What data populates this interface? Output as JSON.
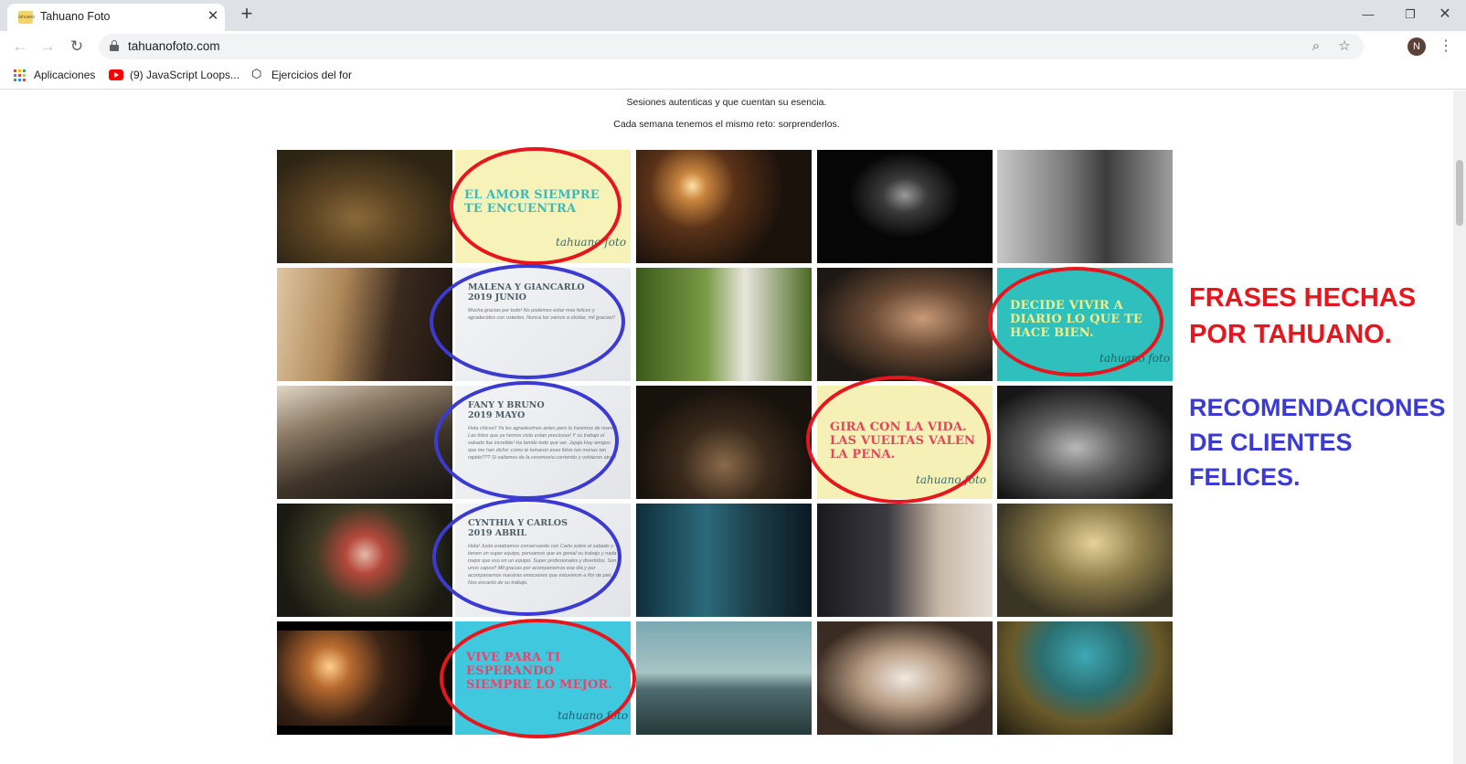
{
  "browser": {
    "tab_title": "Tahuano Foto",
    "favicon_label": "tahuano",
    "url": "tahuanofoto.com",
    "profile_initial": "N",
    "bookmarks": [
      {
        "label": "Aplicaciones"
      },
      {
        "label": "(9) JavaScript Loops..."
      },
      {
        "label": "Ejercicios del for"
      }
    ]
  },
  "page": {
    "intro_lines": [
      "Sesiones autenticas y que cuentan su esencia.",
      "Cada semana tenemos el mismo reto: sorprenderlos."
    ],
    "quote_tiles": {
      "q1": {
        "text": "El amor siempre te encuentra",
        "signature": "tahuano foto"
      },
      "q2": {
        "text": "Decide vivir a diario lo que te hace bien.",
        "signature": "tahuano foto"
      },
      "q3": {
        "text": "Gira con la vida. Las vueltas valen la pena.",
        "signature": "tahuano foto"
      },
      "q4": {
        "text": "Vive para ti esperando siempre lo mejor.",
        "signature": "tahuano foto"
      }
    },
    "review_tiles": {
      "r1": {
        "names": "Malena y Giancarlo",
        "date": "2019 Junio",
        "body": "Mucha gracias por todo! No podemos estar mas felices y agradecidos con ustedes. Nunca los vamos a olvidar, mil gracias!!"
      },
      "r2": {
        "names": "Fany y Bruno",
        "date": "2019 Mayo",
        "body": "Hola chicos!! Ya les agradecimos antes pero lo haremos de nuevo! Las fotos que ya hemos visto estan preciosas! Y su trabajo el sabado fue increible! Ha tenido todo que ver. Jajaja Hay amigos que me han dicho: como te tomaron esas fotos tan monas tan rapido??? Si saliamos de la ceremonia corriendo y volvieron atras!"
      },
      "r3": {
        "names": "Cynthia y Carlos",
        "date": "2019 Abril",
        "body": "Hola! Justo estabamos conversando con Carlo sobre el sabado y tienen un super equipo, pensamos que es genial su trabajo y nada mejor que eso en un equipo. Super profesionales y divertidos. Son unos capos!! Mil gracias por acompanarnos ese dia y por acompanarnos nuestras emociones que estuvieron a flor de piel. Nos encanto de su trabajo."
      }
    },
    "photo_tiles": [
      "photo-couple-trees",
      "photo-backlit-couple",
      "photo-dark-silhouette",
      "photo-bw-toast",
      "photo-bride-smile",
      "photo-bride-garden",
      "photo-couple-forehead",
      "photo-veil-road",
      "photo-couple-wall",
      "photo-bw-embrace",
      "photo-bouquet",
      "photo-window-reflection",
      "photo-kiss-veil",
      "photo-umbrella-kiss",
      "photo-sunset-kiss",
      "photo-beach-couple",
      "photo-dress-back",
      "photo-field-couple"
    ]
  },
  "annotations": {
    "frases_label": "FRASES HECHAS POR TAHUANO.",
    "recomendaciones_label": "RECOMENDACIONES DE CLIENTES FELICES.",
    "red": "#e5161e",
    "blue": "#3b3bd1"
  }
}
